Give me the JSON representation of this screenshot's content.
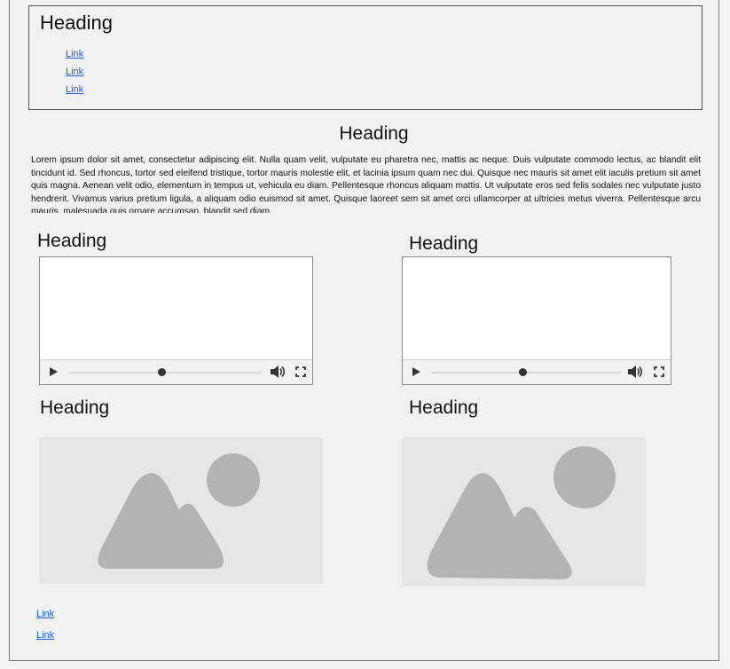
{
  "nav": {
    "heading": "Heading",
    "links": [
      "Link",
      "Link",
      "Link"
    ]
  },
  "intro": {
    "heading": "Heading",
    "body": "Lorem ipsum dolor sit amet, consectetur adipiscing elit. Nulla quam velit, vulputate eu pharetra nec, mattis ac neque. Duis vulputate commodo lectus, ac blandit elit tincidunt id. Sed rhoncus, tortor sed eleifend tristique, tortor mauris molestie elit, et lacinia ipsum quam nec dui. Quisque nec mauris sit amet elit iaculis pretium sit amet quis magna. Aenean velit odio, elementum in tempus ut, vehicula eu diam. Pellentesque rhoncus aliquam mattis. Ut vulputate eros sed felis sodales nec vulputate justo hendrerit. Vivamus varius pretium ligula, a aliquam odio euismod sit amet. Quisque laoreet sem sit amet orci ullamcorper at ultricies metus viverra. Pellentesque arcu mauris, malesuada quis ornare accumsan, blandit sed diam."
  },
  "videos": [
    {
      "heading": "Heading",
      "progress": 0.5
    },
    {
      "heading": "Heading",
      "progress": 0.48
    }
  ],
  "images": [
    {
      "heading": "Heading"
    },
    {
      "heading": "Heading"
    }
  ],
  "footer": {
    "links": [
      "Link",
      "Link"
    ]
  },
  "colors": {
    "link": "#1a5fd6",
    "placeholder_bg": "#e6e6e6",
    "placeholder_shape": "#b3b3b3"
  },
  "icons": [
    "play-icon",
    "volume-icon",
    "fullscreen-icon",
    "image-placeholder-icon"
  ]
}
